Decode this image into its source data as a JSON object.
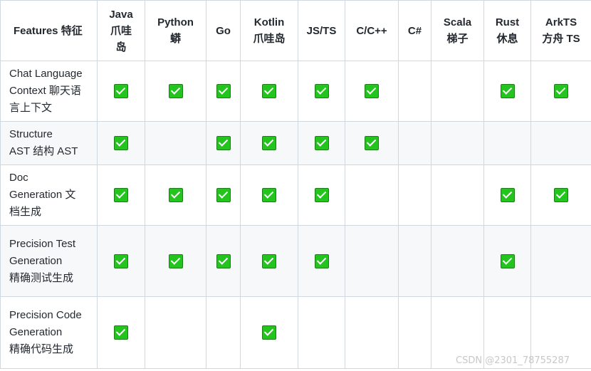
{
  "header": {
    "features": "Features 特征",
    "columns": [
      {
        "lines": [
          "Java",
          "爪哇",
          "岛"
        ]
      },
      {
        "lines": [
          "Python",
          "蟒"
        ]
      },
      {
        "lines": [
          "Go"
        ]
      },
      {
        "lines": [
          "Kotlin",
          "爪哇岛"
        ]
      },
      {
        "lines": [
          "JS/TS"
        ]
      },
      {
        "lines": [
          "C/C++"
        ]
      },
      {
        "lines": [
          "C#"
        ]
      },
      {
        "lines": [
          "Scala",
          "梯子"
        ]
      },
      {
        "lines": [
          "Rust",
          "休息"
        ]
      },
      {
        "lines": [
          "ArkTS",
          "方舟 TS"
        ]
      }
    ]
  },
  "rows": [
    {
      "label": [
        "Chat Language",
        "Context 聊天语",
        "言上下文"
      ],
      "checks": [
        true,
        true,
        true,
        true,
        true,
        true,
        false,
        false,
        true,
        true
      ]
    },
    {
      "label": [
        "Structure",
        "AST 结构 AST"
      ],
      "checks": [
        true,
        false,
        true,
        true,
        true,
        true,
        false,
        false,
        false,
        false
      ]
    },
    {
      "label": [
        "Doc",
        "Generation 文",
        "档生成"
      ],
      "checks": [
        true,
        true,
        true,
        true,
        true,
        false,
        false,
        false,
        true,
        true
      ]
    },
    {
      "label": [
        "Precision Test",
        "Generation",
        "精确测试生成"
      ],
      "checks": [
        true,
        true,
        true,
        true,
        true,
        false,
        false,
        false,
        true,
        false
      ]
    },
    {
      "label": [
        "Precision Code",
        "Generation",
        "精确代码生成"
      ],
      "checks": [
        true,
        false,
        false,
        true,
        false,
        false,
        false,
        false,
        false,
        false
      ]
    }
  ],
  "icons": {
    "check": "checkbox-checked-icon",
    "check_color": "#22c41d"
  },
  "watermark": "CSDN @2301_78755287"
}
